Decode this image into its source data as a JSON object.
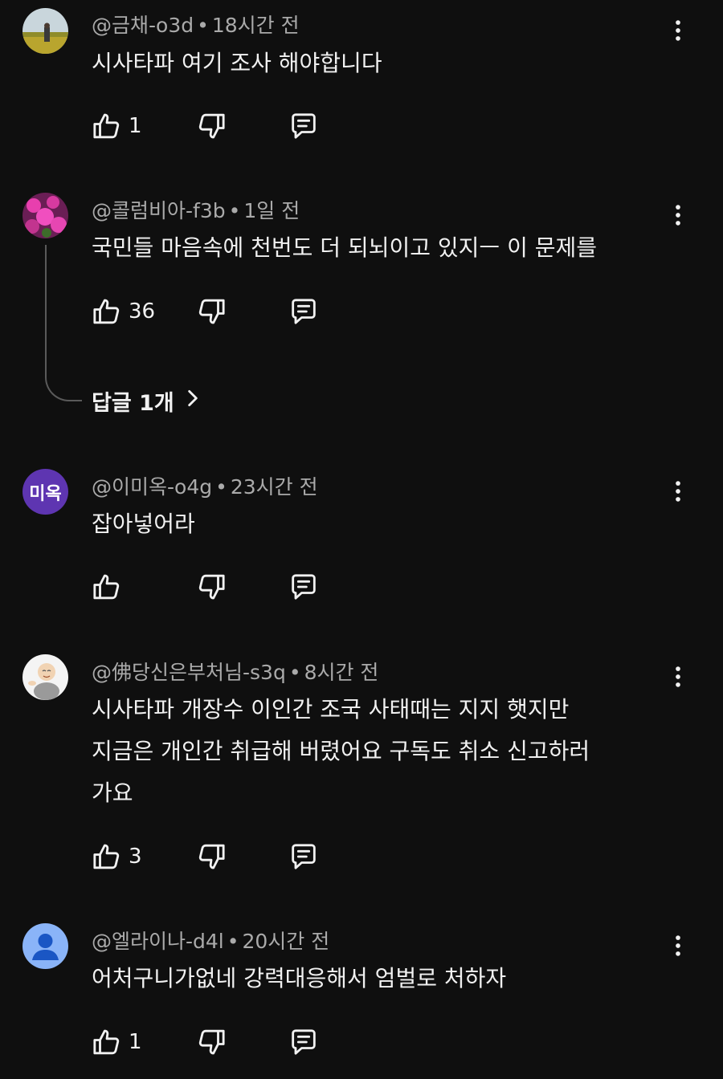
{
  "comments": [
    {
      "author": "@금채-o3d",
      "time": "18시간 전",
      "lines": [
        "시사타파 여기 조사 해야합니다"
      ],
      "likes": "1",
      "avatar": "photo-landscape"
    },
    {
      "author": "@콜럼비아-f3b",
      "time": "1일 전",
      "lines": [
        "국민들 마음속에 천번도 더  되뇌이고 있지ㅡ 이 문제를"
      ],
      "likes": "36",
      "replies_label": "답글 1개",
      "avatar": "photo-flowers"
    },
    {
      "author": "@이미옥-o4g",
      "time": "23시간 전",
      "lines": [
        "잡아넣어라"
      ],
      "likes": "",
      "avatar_initials": "미옥",
      "avatar_color": "#5e35b1"
    },
    {
      "author": "@佛당신은부처님-s3q",
      "time": "8시간 전",
      "lines": [
        "시사타파 개장수 이인간 조국 사태때는 지지 햇지만",
        "지금은 개인간 취급해 버렸어요 구독도 취소 신고하러",
        "가요"
      ],
      "likes": "3",
      "avatar": "monk-illustration"
    },
    {
      "author": "@엘라이나-d4l",
      "time": "20시간 전",
      "lines": [
        "어처구니가없네 강력대응해서 엄벌로 처하자"
      ],
      "likes": "1",
      "avatar": "default-person",
      "avatar_color": "#8ab4f8"
    }
  ],
  "separator": "•",
  "icons": {
    "like": "thumbs-up-icon",
    "dislike": "thumbs-down-icon",
    "reply": "reply-comment-icon",
    "more": "more-vert-icon",
    "chevron": "chevron-right-icon"
  }
}
